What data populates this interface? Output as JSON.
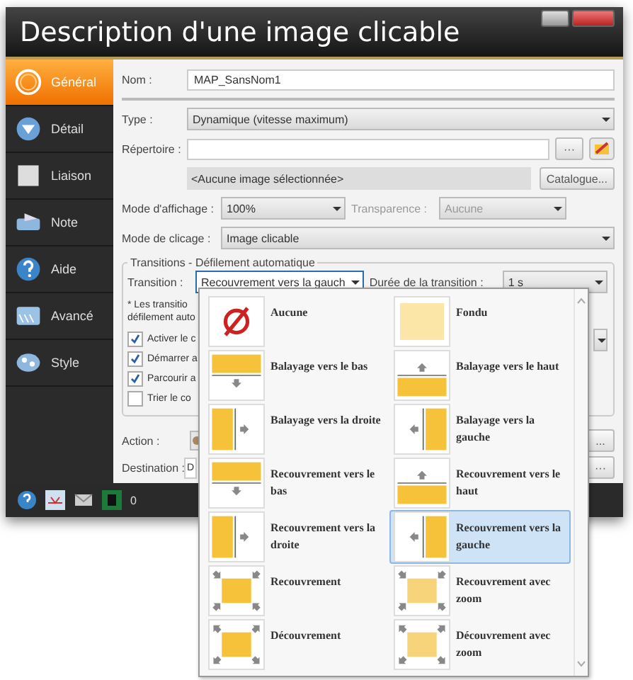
{
  "window": {
    "title": "Description d'une image clicable"
  },
  "sidebar": {
    "items": [
      {
        "label": "Général",
        "selected": true
      },
      {
        "label": "Détail",
        "selected": false
      },
      {
        "label": "Liaison",
        "selected": false
      },
      {
        "label": "Note",
        "selected": false
      },
      {
        "label": "Aide",
        "selected": false
      },
      {
        "label": "Avancé",
        "selected": false
      },
      {
        "label": "Style",
        "selected": false
      }
    ]
  },
  "form": {
    "name": {
      "label": "Nom :",
      "value": "MAP_SansNom1"
    },
    "type": {
      "label": "Type :",
      "value": "Dynamique (vitesse maximum)"
    },
    "directory": {
      "label": "Répertoire :",
      "browse": "···",
      "info": "<Aucune image sélectionnée>",
      "catalog": "Catalogue..."
    },
    "display_mode": {
      "label": "Mode d'affichage :",
      "value": "100%"
    },
    "transparency": {
      "label": "Transparence :",
      "value": "Aucune",
      "disabled": true
    },
    "click_mode": {
      "label": "Mode de clicage :",
      "value": "Image clicable"
    }
  },
  "group": {
    "title": "Transitions - Défilement automatique",
    "transition": {
      "label": "Transition :",
      "value": "Recouvrement vers la gauch",
      "open": true
    },
    "duration": {
      "label": "Durée de la transition :",
      "value": "1 s"
    },
    "note": [
      "* Les transitio",
      "défilement auto"
    ],
    "checkboxes": [
      {
        "label": "Activer le c",
        "checked": true
      },
      {
        "label": "Démarrer a",
        "checked": true
      },
      {
        "label": "Parcourir a",
        "checked": true
      },
      {
        "label": "Trier le co",
        "checked": false
      }
    ]
  },
  "action": {
    "label": "Action :",
    "button": "..."
  },
  "destination": {
    "label": "Destination :",
    "value": "D",
    "button": "···"
  },
  "status_bar": {
    "count": "0"
  },
  "dropdown": {
    "options": [
      {
        "label": "Aucune",
        "kind": "none",
        "selected": false
      },
      {
        "label": "Fondu",
        "kind": "fade",
        "selected": false
      },
      {
        "label": "Balayage vers le bas",
        "kind": "wipe-down",
        "selected": false
      },
      {
        "label": "Balayage vers le haut",
        "kind": "wipe-up",
        "selected": false
      },
      {
        "label": "Balayage vers la droite",
        "kind": "wipe-right",
        "selected": false
      },
      {
        "label": "Balayage vers la gauche",
        "kind": "wipe-left",
        "selected": false
      },
      {
        "label": "Recouvrement vers le bas",
        "kind": "cover-down",
        "selected": false
      },
      {
        "label": "Recouvrement vers le haut",
        "kind": "cover-up",
        "selected": false
      },
      {
        "label": "Recouvrement vers la droite",
        "kind": "cover-right",
        "selected": false
      },
      {
        "label": "Recouvrement vers la gauche",
        "kind": "cover-left",
        "selected": true
      },
      {
        "label": "Recouvrement",
        "kind": "cover",
        "selected": false
      },
      {
        "label": "Recouvrement avec zoom",
        "kind": "cover-zoom",
        "selected": false
      },
      {
        "label": "Découvrement",
        "kind": "uncover",
        "selected": false
      },
      {
        "label": "Découvrement avec zoom",
        "kind": "uncover-zoom",
        "selected": false
      }
    ]
  }
}
